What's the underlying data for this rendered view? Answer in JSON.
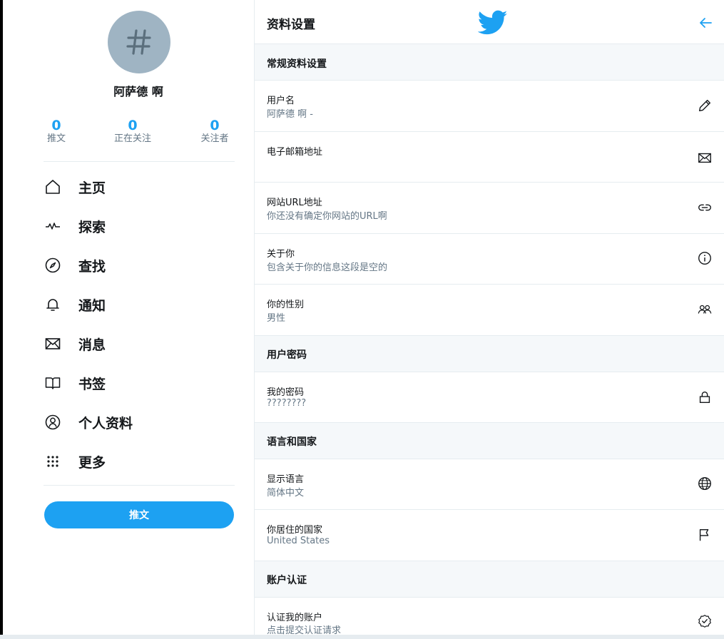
{
  "profile": {
    "avatar_glyph": "#",
    "name": "阿萨德 啊",
    "stats": [
      {
        "value": "0",
        "label": "推文"
      },
      {
        "value": "0",
        "label": "正在关注"
      },
      {
        "value": "0",
        "label": "关注者"
      }
    ]
  },
  "nav": [
    {
      "label": "主页",
      "icon": "home-icon"
    },
    {
      "label": "探索",
      "icon": "activity-icon"
    },
    {
      "label": "查找",
      "icon": "compass-icon"
    },
    {
      "label": "通知",
      "icon": "bell-icon"
    },
    {
      "label": "消息",
      "icon": "mail-icon"
    },
    {
      "label": "书签",
      "icon": "bookmark-book-icon"
    },
    {
      "label": "个人资料",
      "icon": "profile-icon"
    },
    {
      "label": "更多",
      "icon": "more-grid-icon"
    }
  ],
  "tweet_button": "推文",
  "header": {
    "title": "资料设置",
    "brand_icon": "twitter-bird-icon",
    "back_icon": "arrow-left-icon"
  },
  "sections": {
    "general": "常规资料设置",
    "password": "用户密码",
    "language": "语言和国家",
    "verify": "账户认证"
  },
  "rows": {
    "username": {
      "label": "用户名",
      "value": "阿萨德 啊 -",
      "icon": "pencil-icon"
    },
    "email": {
      "label": "电子邮箱地址",
      "value": "",
      "icon": "envelope-icon"
    },
    "website": {
      "label": "网站URL地址",
      "value": "你还没有确定你网站的URL啊",
      "icon": "link-icon"
    },
    "about": {
      "label": "关于你",
      "value": "包含关于你的信息这段是空的",
      "icon": "info-icon"
    },
    "gender": {
      "label": "你的性别",
      "value": "男性",
      "icon": "people-icon"
    },
    "password": {
      "label": "我的密码",
      "value": "????????",
      "icon": "lock-icon"
    },
    "display_language": {
      "label": "显示语言",
      "value": "简体中文",
      "icon": "globe-icon"
    },
    "country": {
      "label": "你居住的国家",
      "value": "United States",
      "icon": "flag-icon"
    },
    "verify_account": {
      "label": "认证我的账户",
      "value": "点击提交认证请求",
      "icon": "badge-check-icon"
    }
  },
  "colors": {
    "accent": "#1da1f2",
    "avatar_bg": "#9fb4c3",
    "section_bg": "#f5f8fa",
    "muted_text": "#657786"
  }
}
